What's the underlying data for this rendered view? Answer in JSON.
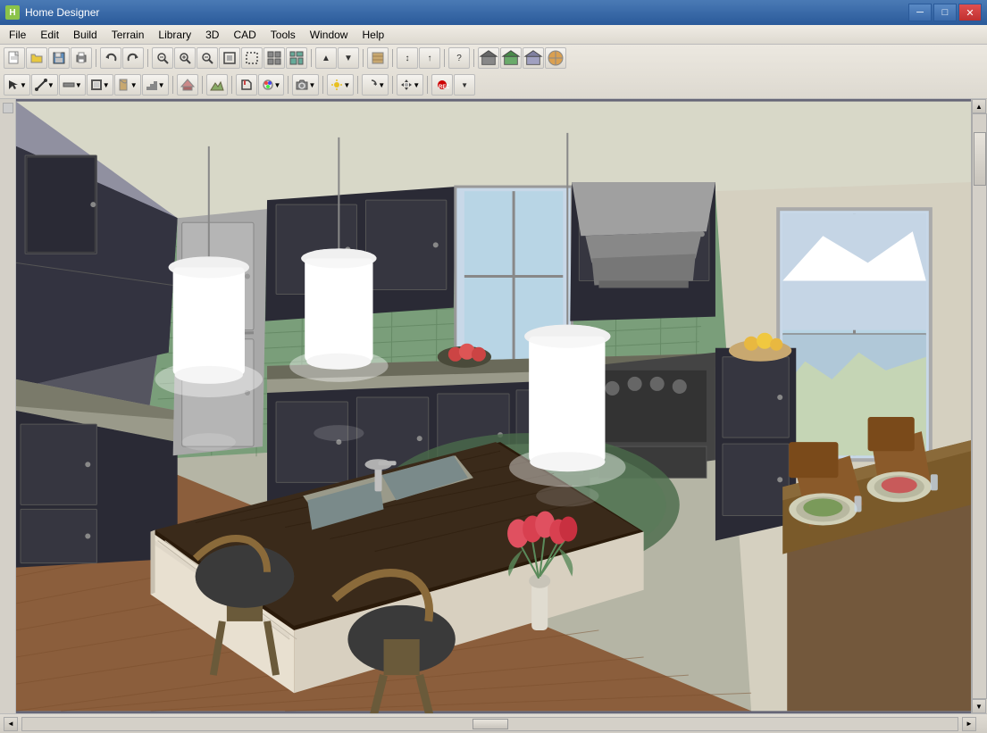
{
  "app": {
    "title": "Home Designer",
    "icon": "HD"
  },
  "titlebar": {
    "controls": {
      "minimize": "─",
      "maximize": "□",
      "close": "✕"
    }
  },
  "menubar": {
    "items": [
      "File",
      "Edit",
      "Build",
      "Terrain",
      "Library",
      "3D",
      "CAD",
      "Tools",
      "Window",
      "Help"
    ]
  },
  "toolbar1": {
    "buttons": [
      {
        "name": "new",
        "icon": "📄"
      },
      {
        "name": "open",
        "icon": "📂"
      },
      {
        "name": "save",
        "icon": "💾"
      },
      {
        "name": "print",
        "icon": "🖨"
      },
      {
        "name": "undo",
        "icon": "↩"
      },
      {
        "name": "redo",
        "icon": "↪"
      },
      {
        "name": "zoom-out",
        "icon": "🔍"
      },
      {
        "name": "zoom-in-glass",
        "icon": "⊕"
      },
      {
        "name": "zoom-in2",
        "icon": "⊕"
      },
      {
        "name": "zoom-out2",
        "icon": "⊖"
      },
      {
        "name": "fit",
        "icon": "⊞"
      },
      {
        "name": "ext1",
        "icon": "⊟"
      },
      {
        "name": "ext2",
        "icon": "◫"
      },
      {
        "name": "arrow-up",
        "icon": "▲"
      },
      {
        "name": "arrow-down",
        "icon": "▼"
      },
      {
        "name": "camera",
        "icon": "📷"
      },
      {
        "name": "measure",
        "icon": "↕"
      },
      {
        "name": "up-arrow",
        "icon": "↑"
      },
      {
        "name": "help",
        "icon": "?"
      },
      {
        "name": "house1",
        "icon": "⌂"
      },
      {
        "name": "house2",
        "icon": "⌂"
      },
      {
        "name": "house3",
        "icon": "⌂"
      }
    ]
  },
  "toolbar2": {
    "buttons": [
      {
        "name": "select",
        "icon": "↖"
      },
      {
        "name": "draw-line",
        "icon": "╱"
      },
      {
        "name": "draw-wall",
        "icon": "═"
      },
      {
        "name": "door",
        "icon": "▭"
      },
      {
        "name": "window",
        "icon": "⊡"
      },
      {
        "name": "stairs",
        "icon": "≡"
      },
      {
        "name": "roof",
        "icon": "⌂"
      },
      {
        "name": "terrain",
        "icon": "◬"
      },
      {
        "name": "paint",
        "icon": "✏"
      },
      {
        "name": "color",
        "icon": "🎨"
      },
      {
        "name": "camera2",
        "icon": "📷"
      },
      {
        "name": "sun",
        "icon": "☀"
      },
      {
        "name": "rotate",
        "icon": "↻"
      },
      {
        "name": "rec",
        "icon": "⏺"
      }
    ]
  },
  "statusbar": {
    "text": ""
  },
  "scene": {
    "description": "3D kitchen interior render",
    "background_color": "#c5c5b5"
  }
}
